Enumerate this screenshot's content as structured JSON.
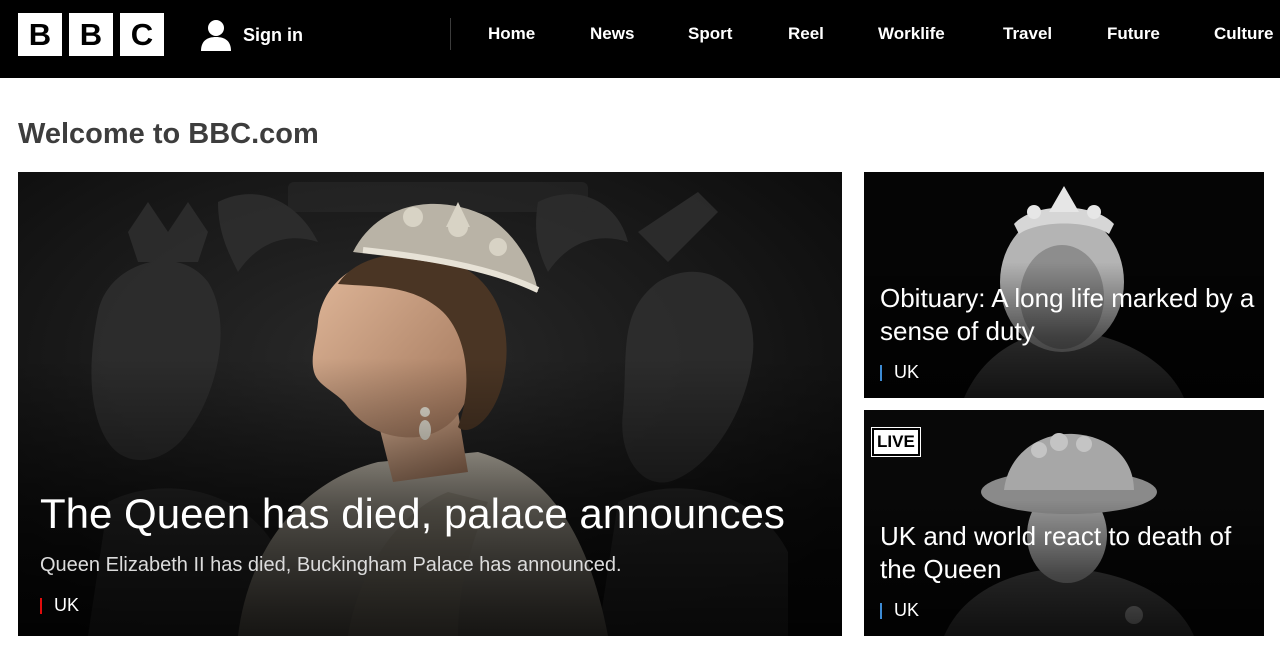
{
  "header": {
    "logo_letters": [
      "B",
      "B",
      "C"
    ],
    "sign_in_label": "Sign in",
    "sign_in_icon": "user-icon",
    "nav": [
      "Home",
      "News",
      "Sport",
      "Reel",
      "Worklife",
      "Travel",
      "Future",
      "Culture"
    ]
  },
  "welcome_heading": "Welcome to BBC.com",
  "main_story": {
    "title": "The Queen has died, palace announces",
    "summary": "Queen Elizabeth II has died, Buckingham Palace has announced.",
    "tag": "UK",
    "tag_color": "#e10c0c"
  },
  "side_stories": [
    {
      "title": "Obituary: A long life marked by a sense of duty",
      "tag": "UK",
      "tag_color": "#3d8bd4"
    },
    {
      "badge": "LIVE",
      "title": "UK and world react to death of the Queen",
      "tag": "UK",
      "tag_color": "#3d8bd4"
    }
  ],
  "colors": {
    "header_bg": "#000000",
    "heading_text": "#3d3d3d"
  }
}
